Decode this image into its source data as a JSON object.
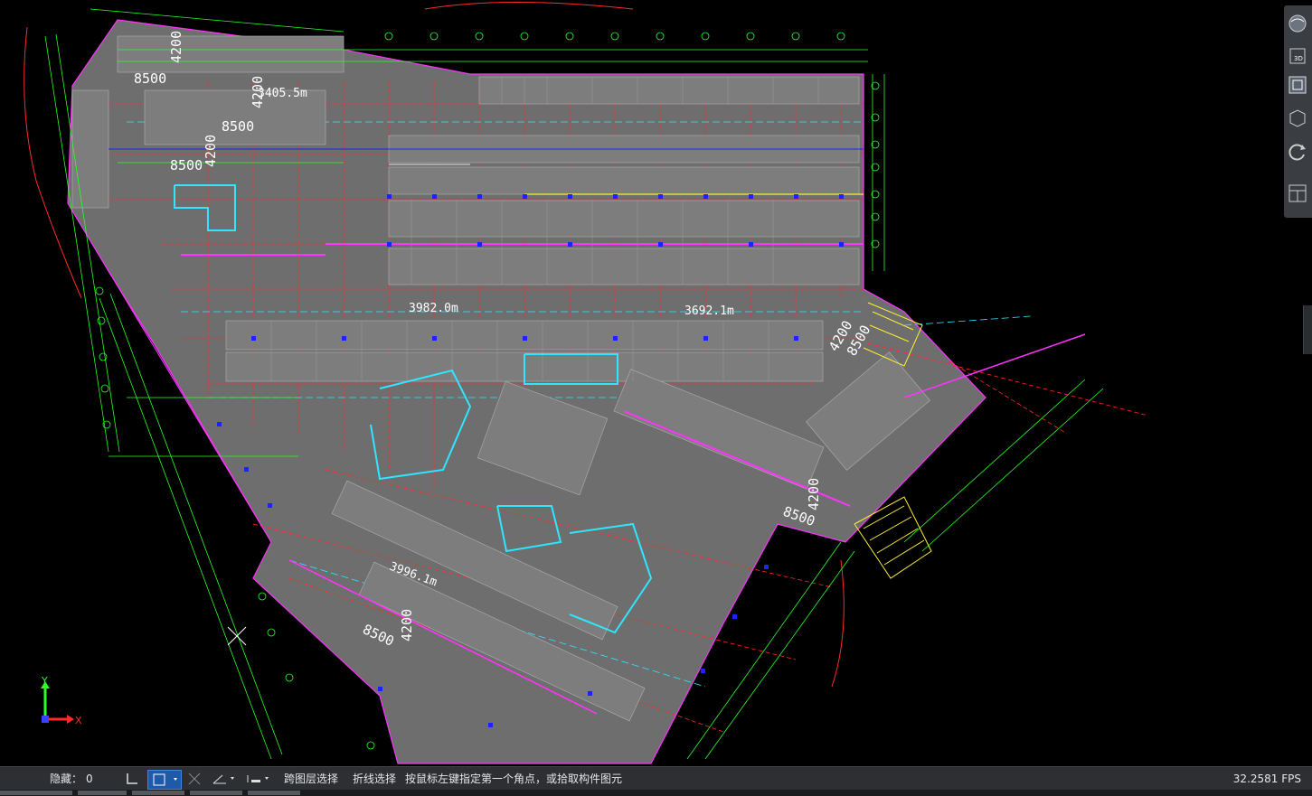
{
  "statusbar": {
    "hidden_label": "隐藏：",
    "hidden_count": "0",
    "cross_layer_select": "跨图层选择",
    "polyline_select": "折线选择",
    "prompt": "按鼠标左键指定第一个角点，或拾取构件图元",
    "fps": "32.2581 FPS"
  },
  "drawing": {
    "area_labels": [
      "3405.5m",
      "3982.0m",
      "3692.1m",
      "3996.1m"
    ],
    "dim_labels": [
      "8500",
      "4200",
      "8500",
      "4200",
      "8500",
      "4200",
      "8500",
      "4200",
      "8500",
      "4200",
      "8500",
      "4200"
    ],
    "axis_x": "X",
    "axis_y": "Y"
  },
  "nav": {
    "buttons": [
      "orbit-icon",
      "3d-view-icon",
      "top-view-icon",
      "iso-view-icon",
      "rotate-icon",
      "layout-icon"
    ]
  },
  "colors": {
    "floor": "#6e6e6e",
    "grid_red": "#ff2a2a",
    "grid_green": "#2aff2a",
    "cyan": "#2ee6ff",
    "magenta": "#ff33ff",
    "blue_col": "#1a22ff",
    "yellow": "#ffee33"
  }
}
